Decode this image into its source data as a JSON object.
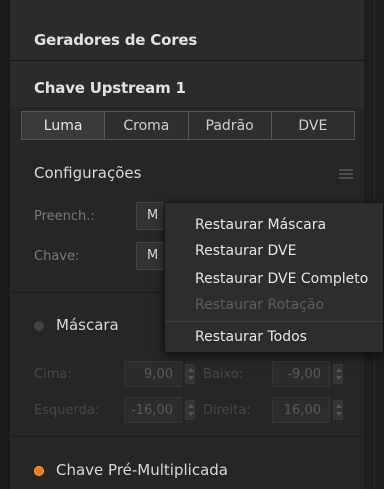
{
  "panel": {
    "color_generators_title": "Geradores de Cores",
    "upstream_key_title": "Chave Upstream 1",
    "tabs": [
      {
        "label": "Luma",
        "active": true
      },
      {
        "label": "Croma",
        "active": false
      },
      {
        "label": "Padrão",
        "active": false
      },
      {
        "label": "DVE",
        "active": false
      }
    ],
    "settings_title": "Configurações",
    "fill": {
      "label": "Preench.:",
      "value": "M"
    },
    "key": {
      "label": "Chave:",
      "value": "M"
    },
    "mask": {
      "label": "Máscara",
      "enabled": false
    },
    "top": {
      "label": "Cima:",
      "value": "9,00"
    },
    "bottom": {
      "label": "Baixo:",
      "value": "-9,00"
    },
    "left": {
      "label": "Esquerda:",
      "value": "-16,00"
    },
    "right": {
      "label": "Direita:",
      "value": "16,00"
    },
    "premultiplied": {
      "label": "Chave Pré-Multiplicada",
      "enabled": true
    }
  },
  "context_menu": {
    "items": [
      {
        "label": "Restaurar Máscara",
        "enabled": true
      },
      {
        "label": "Restaurar DVE",
        "enabled": true
      },
      {
        "label": "Restaurar DVE Completo",
        "enabled": true
      },
      {
        "label": "Restaurar Rotação",
        "enabled": false
      },
      {
        "label": "Restaurar Todos",
        "enabled": true
      }
    ]
  },
  "colors": {
    "accent": "#e87b25",
    "panel_bg": "#262626",
    "menu_bg": "#2d2d2d"
  }
}
